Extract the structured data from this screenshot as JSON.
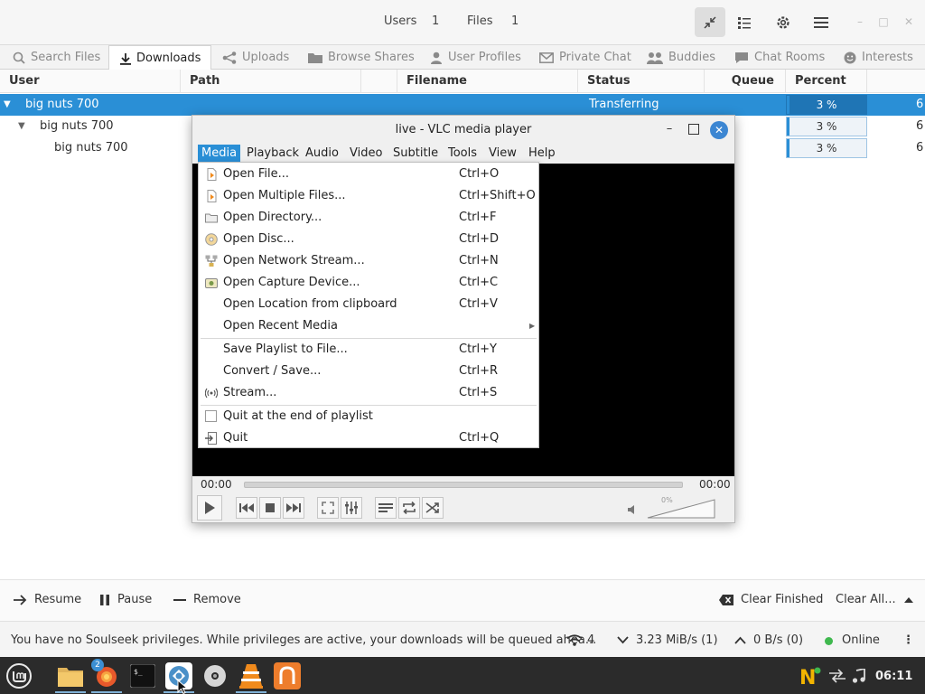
{
  "header": {
    "users_label": "Users",
    "users_count": "1",
    "files_label": "Files",
    "files_count": "1"
  },
  "tabs": [
    {
      "label": "Search Files",
      "icon": "search-icon"
    },
    {
      "label": "Downloads",
      "icon": "download-icon",
      "active": true
    },
    {
      "label": "Uploads",
      "icon": "share-icon"
    },
    {
      "label": "Browse Shares",
      "icon": "folder-icon"
    },
    {
      "label": "User Profiles",
      "icon": "user-icon"
    },
    {
      "label": "Private Chat",
      "icon": "mail-icon"
    },
    {
      "label": "Buddies",
      "icon": "users-icon"
    },
    {
      "label": "Chat Rooms",
      "icon": "chat-icon"
    },
    {
      "label": "Interests",
      "icon": "smile-icon"
    }
  ],
  "table": {
    "columns": [
      "User",
      "Path",
      "Filename",
      "Status",
      "Queue",
      "Percent"
    ],
    "rows": [
      {
        "user": "big nuts 700",
        "status": "Transferring",
        "percent": "3 %",
        "progress": 0.03,
        "extra": "6"
      },
      {
        "user": "big nuts 700",
        "status": "",
        "percent": "3 %",
        "progress": 0.03,
        "extra": "6"
      },
      {
        "user": "big nuts 700",
        "status": "",
        "percent": "3 %",
        "progress": 0.03,
        "extra": "6"
      }
    ]
  },
  "actions": {
    "resume": "Resume",
    "pause": "Pause",
    "remove": "Remove",
    "clear_finished": "Clear Finished",
    "clear_all": "Clear All..."
  },
  "status_bar": {
    "message": "You have no Soulseek privileges. While privileges are active, your downloads will be queued ahea...",
    "connections": "4",
    "download_speed": "3.23 MiB/s (1)",
    "upload_speed": "0 B/s (0)",
    "online": "Online"
  },
  "vlc": {
    "title": "live - VLC media player",
    "menus": [
      "Media",
      "Playback",
      "Audio",
      "Video",
      "Subtitle",
      "Tools",
      "View",
      "Help"
    ],
    "time_left": "00:00",
    "time_right": "00:00",
    "volume": "0%"
  },
  "media_menu": {
    "groups": [
      [
        {
          "label": "Open File...",
          "shortcut": "Ctrl+O",
          "icon": "file-icon"
        },
        {
          "label": "Open Multiple Files...",
          "shortcut": "Ctrl+Shift+O",
          "icon": "files-icon"
        },
        {
          "label": "Open Directory...",
          "shortcut": "Ctrl+F",
          "icon": "folder-icon"
        },
        {
          "label": "Open Disc...",
          "shortcut": "Ctrl+D",
          "icon": "disc-icon"
        },
        {
          "label": "Open Network Stream...",
          "shortcut": "Ctrl+N",
          "icon": "network-icon"
        },
        {
          "label": "Open Capture Device...",
          "shortcut": "Ctrl+C",
          "icon": "capture-icon"
        },
        {
          "label": "Open Location from clipboard",
          "shortcut": "Ctrl+V",
          "icon": ""
        },
        {
          "label": "Open Recent Media",
          "shortcut": "",
          "icon": "",
          "submenu": true
        }
      ],
      [
        {
          "label": "Save Playlist to File...",
          "shortcut": "Ctrl+Y",
          "icon": ""
        },
        {
          "label": "Convert / Save...",
          "shortcut": "Ctrl+R",
          "icon": ""
        },
        {
          "label": "Stream...",
          "shortcut": "Ctrl+S",
          "icon": "stream-icon"
        }
      ],
      [
        {
          "label": "Quit at the end of playlist",
          "shortcut": "",
          "icon": "checkbox-icon"
        },
        {
          "label": "Quit",
          "shortcut": "Ctrl+Q",
          "icon": "quit-icon"
        }
      ]
    ]
  },
  "taskbar": {
    "badge": "2",
    "clock": "06:11"
  },
  "colors": {
    "selection": "#2a8fd6",
    "vlc_orange": "#f08a1c",
    "taskbar": "#2b2b2b",
    "online": "#3fb84e"
  }
}
